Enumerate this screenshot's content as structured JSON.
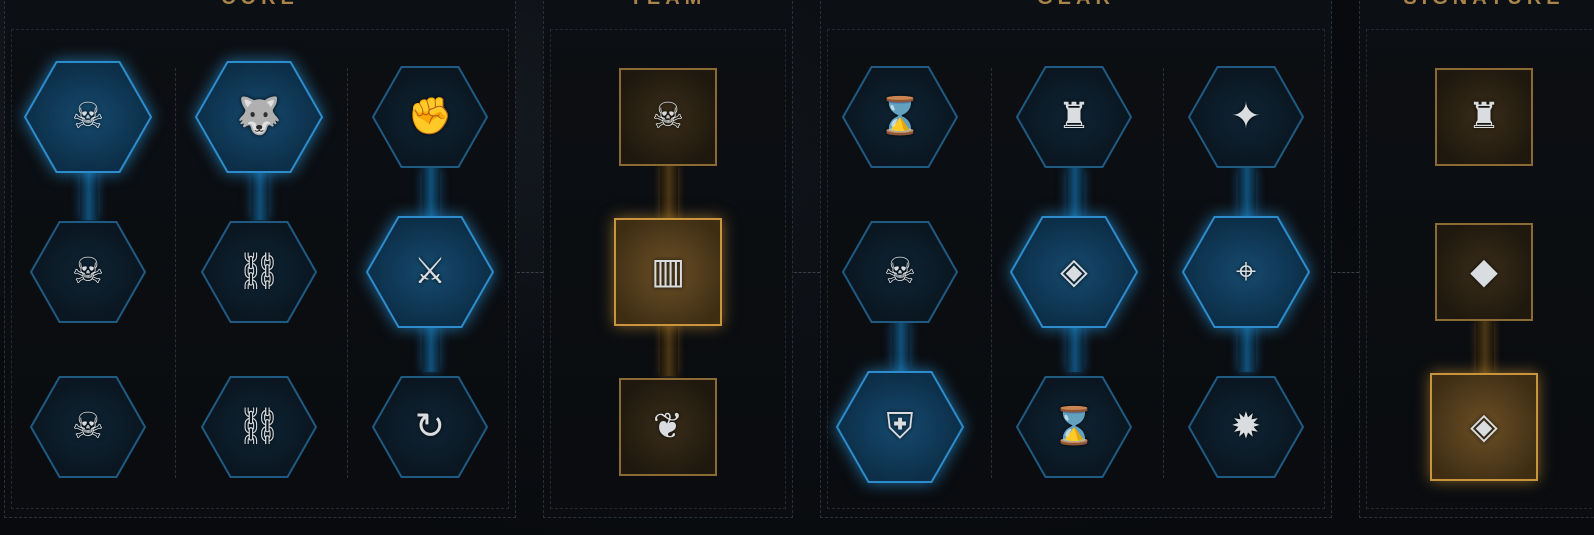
{
  "panels": {
    "core": {
      "title": "CORE"
    },
    "team": {
      "title": "TEAM"
    },
    "gear": {
      "title": "GEAR"
    },
    "signature": {
      "title": "SIGNATURE"
    }
  },
  "nodes": {
    "core": [
      {
        "icon": "skulls-shield-plus-icon",
        "glyph": "☠",
        "state": "active"
      },
      {
        "icon": "wolf-rank-up-icon",
        "glyph": "🐺",
        "state": "active"
      },
      {
        "icon": "glove-strike-icon",
        "glyph": "✊",
        "state": "inactive"
      },
      {
        "icon": "skulls-bolter-ammo-icon",
        "glyph": "☠",
        "state": "inactive"
      },
      {
        "icon": "chain-link-burst-icon",
        "glyph": "⛓",
        "state": "inactive"
      },
      {
        "icon": "crossed-guns-dome-icon",
        "glyph": "⚔",
        "state": "active"
      },
      {
        "icon": "skulls-ammo-crate-icon",
        "glyph": "☠",
        "state": "inactive"
      },
      {
        "icon": "chain-plus-weight-icon",
        "glyph": "⛓",
        "state": "inactive"
      },
      {
        "icon": "pistol-reload-icon",
        "glyph": "↻",
        "state": "inactive"
      }
    ],
    "team": [
      {
        "icon": "skull-target-icon",
        "glyph": "☠",
        "state": "inactive"
      },
      {
        "icon": "ammo-crate-rank-icon",
        "glyph": "▥",
        "state": "active"
      },
      {
        "icon": "winged-chain-icon",
        "glyph": "❦",
        "state": "inactive"
      }
    ],
    "gear": [
      {
        "icon": "hourglass-shield-icon",
        "glyph": "⌛",
        "state": "inactive"
      },
      {
        "icon": "marine-dome-icon",
        "glyph": "♜",
        "state": "inactive"
      },
      {
        "icon": "winged-rank-icon",
        "glyph": "✦",
        "state": "inactive"
      },
      {
        "icon": "skulls-crate-arrows-icon",
        "glyph": "☠",
        "state": "inactive"
      },
      {
        "icon": "diamond-armor-icon",
        "glyph": "◈",
        "state": "active"
      },
      {
        "icon": "target-arrows-icon",
        "glyph": "⌖",
        "state": "active"
      },
      {
        "icon": "shield-plus-icon",
        "glyph": "⛨",
        "state": "active"
      },
      {
        "icon": "hourglass-dome-icon",
        "glyph": "⌛",
        "state": "inactive"
      },
      {
        "icon": "explosion-dome-icon",
        "glyph": "✹",
        "state": "inactive"
      }
    ],
    "signature": [
      {
        "icon": "marine-aura-icon",
        "glyph": "♜",
        "state": "inactive"
      },
      {
        "icon": "bolter-diamond-icon",
        "glyph": "◆",
        "state": "inactive"
      },
      {
        "icon": "diamond-wings-icon",
        "glyph": "◈",
        "state": "active"
      }
    ]
  },
  "colors": {
    "accent_gold": "#a8834a",
    "blue_active": "#1d6a9c",
    "blue_inactive": "#1b4a6a",
    "gold_active": "#c8953d"
  }
}
